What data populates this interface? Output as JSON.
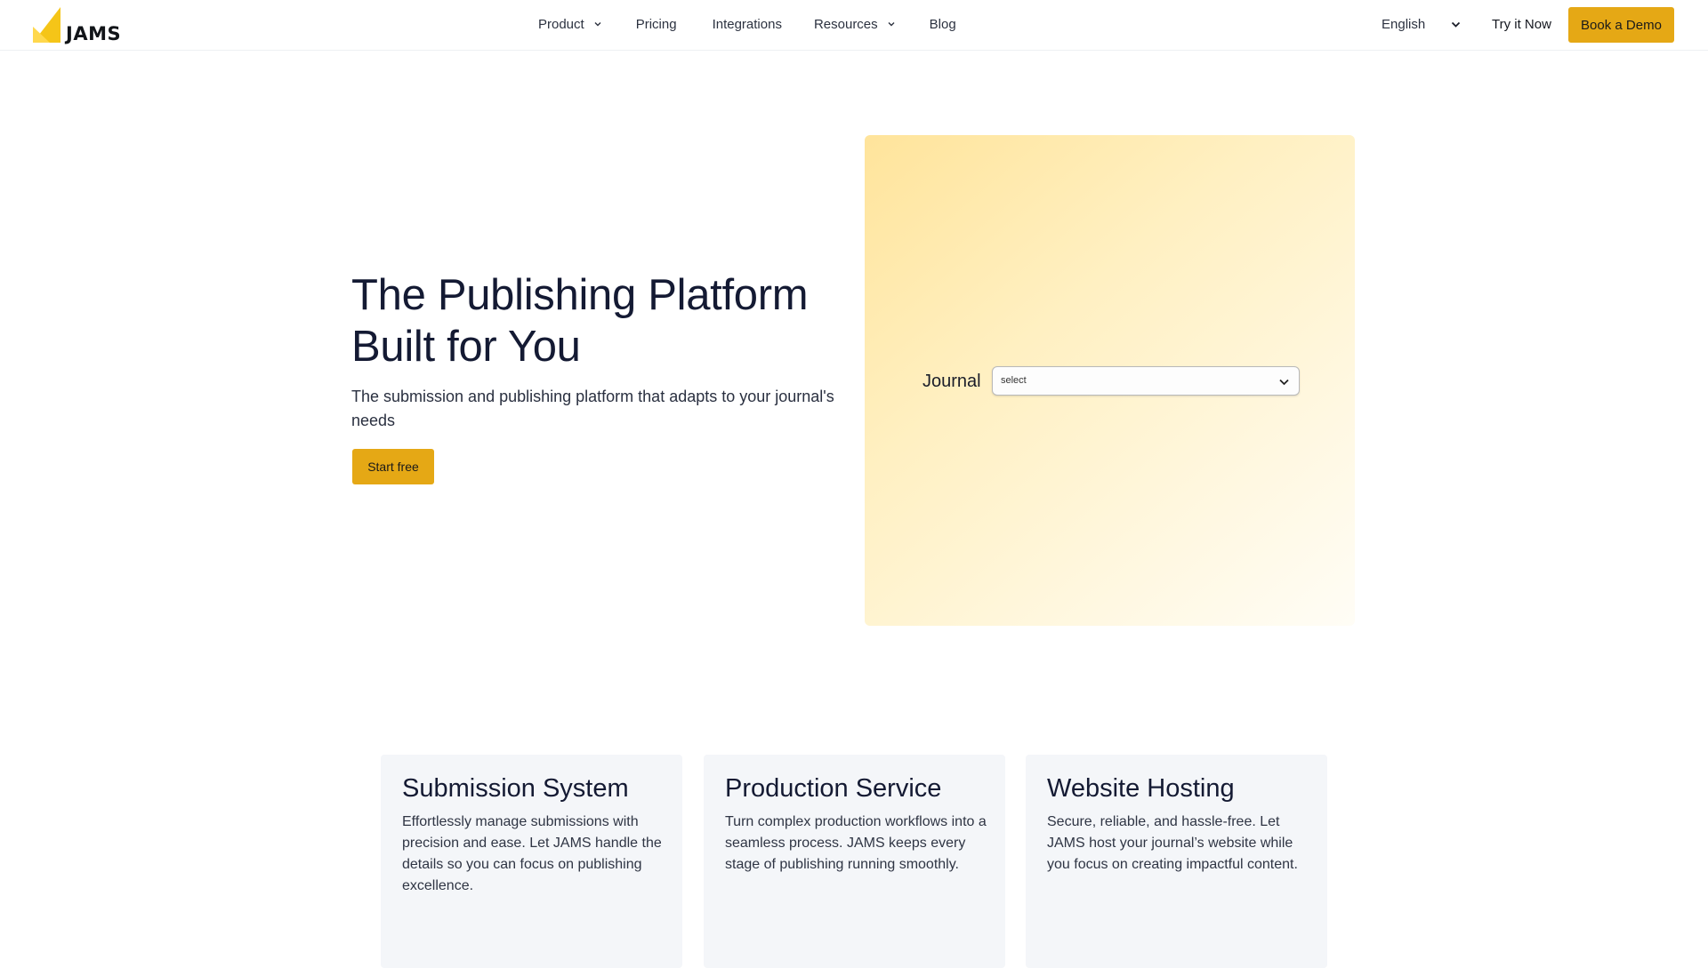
{
  "brand": {
    "name": "JAMS",
    "accent_color": "#e5a815",
    "logo_color": "#f5c518"
  },
  "nav": {
    "items": [
      {
        "label": "Product",
        "has_dropdown": true,
        "icon": "chevron-down-icon"
      },
      {
        "label": "Pricing",
        "has_dropdown": false
      },
      {
        "label": "Integrations",
        "has_dropdown": false
      },
      {
        "label": "Resources",
        "has_dropdown": true,
        "icon": "chevron-down-icon"
      },
      {
        "label": "Blog",
        "has_dropdown": false
      }
    ],
    "language": {
      "label": "English",
      "icon": "chevron-down-icon"
    },
    "try_label": "Try it Now",
    "demo_label": "Book a Demo"
  },
  "hero": {
    "title": "The Publishing Platform Built for You",
    "subtitle": "The submission and publishing platform that adapts to your journal's needs",
    "cta_label": "Start free",
    "journal_label": "Journal",
    "journal_select_value": "select"
  },
  "features": [
    {
      "title": "Submission System",
      "description": "Effortlessly manage submissions with precision and ease. Let JAMS handle the details so you can focus on publishing excellence."
    },
    {
      "title": "Production Service",
      "description": "Turn complex production workflows into a seamless process. JAMS keeps every stage of publishing running smoothly."
    },
    {
      "title": "Website Hosting",
      "description": "Secure, reliable, and hassle-free. Let JAMS host your journal’s website while you focus on creating impactful content."
    }
  ]
}
